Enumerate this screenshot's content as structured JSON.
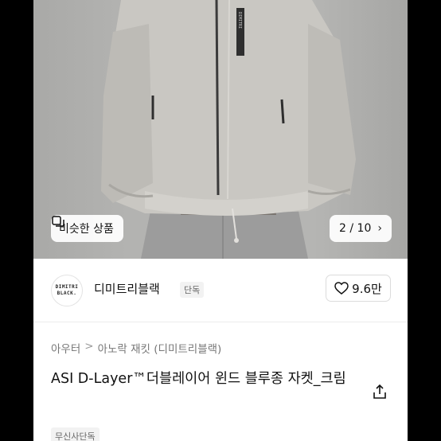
{
  "product_image": {
    "similar_button_label": "비슷한 상품",
    "counter": "2 / 10",
    "counter_chevron": "›",
    "icons": [
      "similar-items-icon",
      "chevron-right-icon"
    ]
  },
  "brand": {
    "logo_text_line1": "DIMITRI",
    "logo_text_line2": "BLACK.",
    "name": "디미트리블랙",
    "badge": "단독",
    "likes": "9.6만",
    "like_icon": "heart-icon"
  },
  "breadcrumb": {
    "items": [
      "아우터",
      "아노락 재킷 (디미트리블랙)"
    ],
    "separator": ">"
  },
  "product": {
    "title": "ASI D-Layer™더블레이어 윈드 블루종 자켓_크림",
    "share_icon": "share-icon",
    "tag": "무신사단독"
  },
  "colors": {
    "background": "#000000",
    "surface": "#ffffff",
    "text": "#111111",
    "muted": "#777777"
  }
}
